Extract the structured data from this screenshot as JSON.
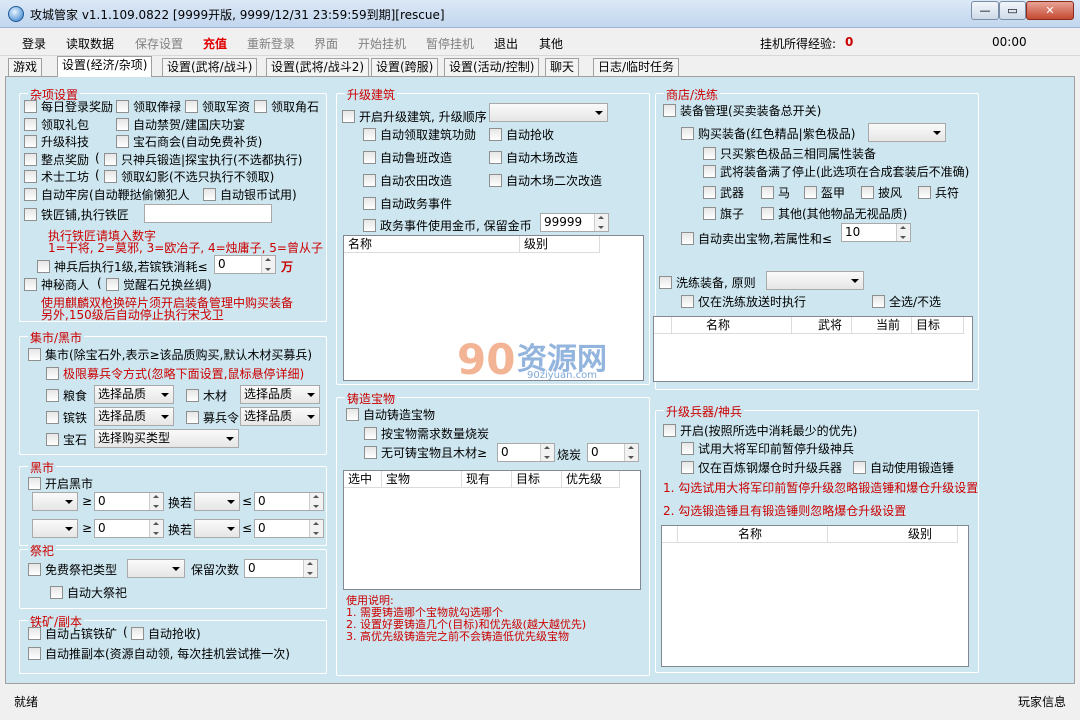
{
  "window": {
    "title": "攻城管家 v1.1.109.0822 [9999开版, 9999/12/31 23:59:59到期][rescue]"
  },
  "menu": {
    "items": [
      "登录",
      "读取数据",
      "保存设置",
      "充值",
      "重新登录",
      "界面",
      "开始挂机",
      "暂停挂机",
      "退出",
      "其他"
    ],
    "exp_label": "挂机所得经验:",
    "exp_value": "0",
    "time": "00:00"
  },
  "tabs": [
    "游戏",
    "设置(经济/杂项)",
    "设置(武将/战斗)",
    "设置(武将/战斗2)",
    "设置(跨服)",
    "设置(活动/控制)",
    "聊天",
    "日志/临时任务"
  ],
  "misc": {
    "title": "杂项设置",
    "daily_login": "每日登录奖励",
    "salary": "领取俸禄",
    "military": "领取军资",
    "horn": "领取角石",
    "gift": "领取礼包",
    "ban": "自动禁贺/建国庆功宴",
    "tech": "升级科技",
    "gem_shop": "宝石商会(自动免费补货)",
    "hourly": "整点奖励",
    "smith_prefix": "只神兵锻造|探宝执行(不选都执行)",
    "warlock": "术士工坊",
    "illusion": "领取幻影(不选只执行不领取)",
    "jail": "自动牢房(自动鞭挞偷懒犯人",
    "silver": "自动银币试用)",
    "smithy": "铁匠铺,执行铁匠",
    "smith_hint_title": "执行铁匠请填入数字",
    "smith_hint": "1=干将, 2=莫邪, 3=欧冶子, 4=烛庸子, 5=曾从子",
    "divine": "神兵后执行1级,若镔铁消耗≤",
    "divine_val": "0",
    "wan": "万",
    "mystery": "神秘商人",
    "awaken": "觉醒石兑换丝绸)",
    "mystery_note1": "使用麒麟双枪换碎片须开启装备管理中购买装备",
    "mystery_note2": "另外,150级后自动停止执行宋戈卫"
  },
  "market": {
    "title": "集市/黑市",
    "market": "集市(除宝石外,表示≥该品质购买,默认木材买募兵)",
    "extreme": "极限募兵令方式(忽略下面设置,鼠标悬停详细)",
    "food": "粮食",
    "wood": "木材",
    "iron": "镔铁",
    "recruit": "募兵令",
    "gem": "宝石",
    "choose": "选择品质",
    "choose_type": "选择购买类型"
  },
  "black": {
    "title": "黑市",
    "open": "开启黑市",
    "ge": "≥",
    "le": "≤",
    "exchange": "换若",
    "zero": "0"
  },
  "sacrifice": {
    "title": "祭祀",
    "free": "免费祭祀类型",
    "keep": "保留次数",
    "keep_val": "0",
    "big": "自动大祭祀"
  },
  "mine": {
    "title": "铁矿/副本",
    "iron": "自动占镔铁矿",
    "grab": "自动抢收)",
    "push": "自动推副本(资源自动领, 每次挂机尝试推一次)"
  },
  "build": {
    "title": "升级建筑",
    "open": "开启升级建筑, 升级顺序",
    "b1": "自动领取建筑功勋",
    "b2": "自动抢收",
    "b3": "自动鲁班改造",
    "b4": "自动木场改造",
    "b5": "自动农田改造",
    "b6": "自动木场二次改造",
    "b7": "自动政务事件",
    "b8": "政务事件使用金币, 保留金币",
    "gold": "99999",
    "cols": [
      "名称",
      "级别"
    ]
  },
  "forge": {
    "title": "铸造宝物",
    "auto": "自动铸造宝物",
    "need": "按宝物需求数量烧炭",
    "none": "无可铸宝物且木材≥",
    "wood_val": "0",
    "burn": "烧炭",
    "burn_val": "0",
    "cols": [
      "选中",
      "宝物",
      "现有",
      "目标",
      "优先级"
    ],
    "note_title": "使用说明:",
    "note1": "1. 需要铸造哪个宝物就勾选哪个",
    "note2": "2. 设置好要铸造几个(目标)和优先级(越大越优先)",
    "note3": "3. 高优先级铸造完之前不会铸造低优先级宝物"
  },
  "shop": {
    "title": "商店/洗练",
    "equip": "装备管理(买卖装备总开关)",
    "buy": "购买装备(红色精品|紫色极品)",
    "purple": "只买紫色极品三相同属性装备",
    "full": "武将装备满了停止(此选项在合成套装后不准确)",
    "weapon": "武器",
    "horse": "马",
    "armor": "盔甲",
    "cloak": "披风",
    "talisman": "兵符",
    "flag": "旗子",
    "other": "其他(其他物品无视品质)",
    "sell": "自动卖出宝物,若属性和≤",
    "sell_val": "10",
    "wash": "洗练装备, 原则",
    "only_free": "仅在洗练放送时执行",
    "all": "全选/不选",
    "cols": [
      "名称",
      "武将",
      "当前",
      "目标"
    ]
  },
  "weapon": {
    "title": "升级兵器/神兵",
    "open": "开启(按照所选中消耗最少的优先)",
    "trial": "试用大将军印前暂停升级神兵",
    "only": "仅在百炼钢爆仓时升级兵器",
    "hammer": "自动使用锻造锤",
    "tip1": "1. 勾选试用大将军印前暂停升级忽略锻造锤和爆仓升级设置",
    "tip2": "2. 勾选锻造锤且有锻造锤则忽略爆仓升级设置",
    "cols": [
      "名称",
      "级别"
    ]
  },
  "watermark": {
    "big": "资源网",
    "small": "90ziyuan.com"
  },
  "status": {
    "left": "就绪",
    "right": "玩家信息"
  }
}
